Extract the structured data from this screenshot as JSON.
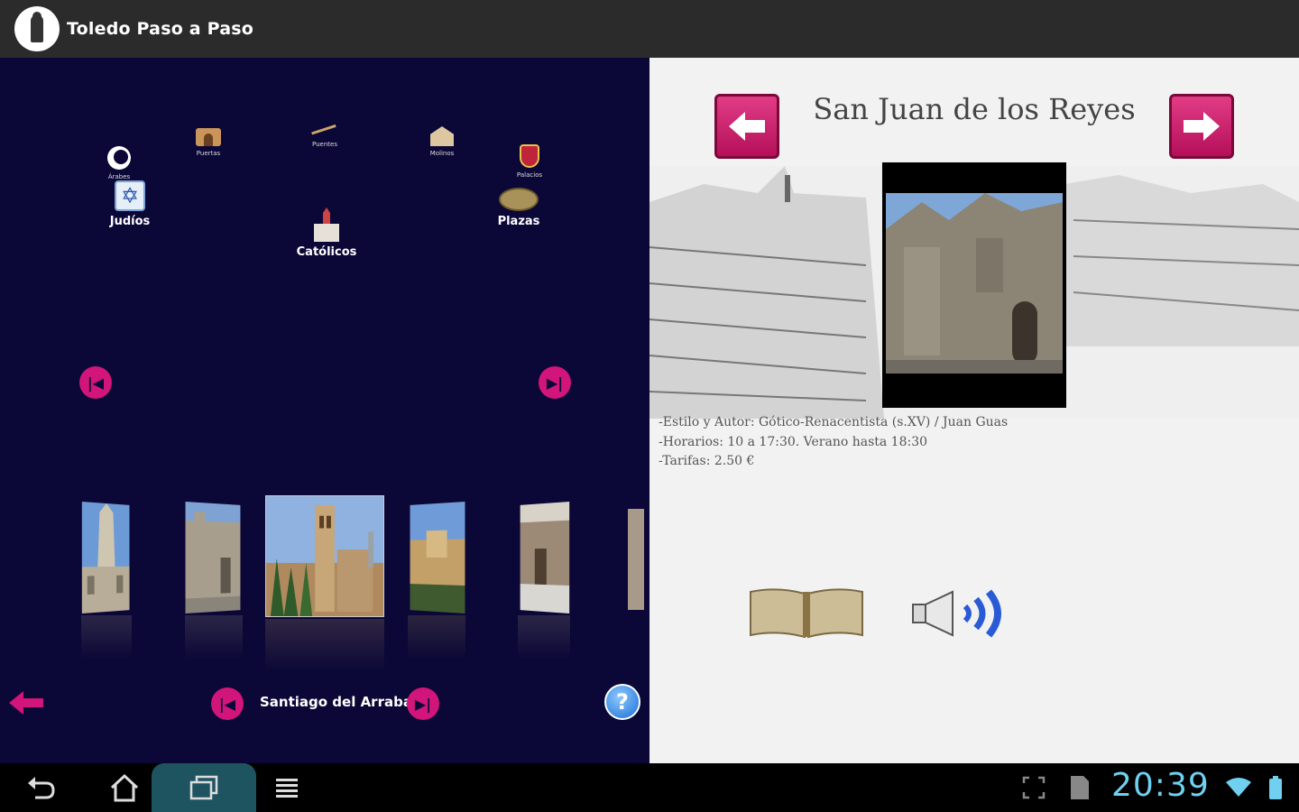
{
  "app": {
    "title": "Toledo Paso a Paso",
    "logo_icon": "walker-logo-icon"
  },
  "categories": [
    {
      "id": "arabes",
      "label": "Árabes",
      "icon": "crescent-moon-icon"
    },
    {
      "id": "judios",
      "label": "Judíos",
      "icon": "star-of-david-icon"
    },
    {
      "id": "puertas",
      "label": "Puertas",
      "icon": "arch-gate-icon"
    },
    {
      "id": "puentes",
      "label": "Puentes",
      "icon": "bridge-icon"
    },
    {
      "id": "molinos",
      "label": "Molinos",
      "icon": "mill-icon"
    },
    {
      "id": "catolicos",
      "label": "Católicos",
      "icon": "church-icon"
    },
    {
      "id": "palacios",
      "label": "Palacios",
      "icon": "shield-icon"
    },
    {
      "id": "plazas",
      "label": "Plazas",
      "icon": "plaza-icon"
    }
  ],
  "carousel": {
    "current_label": "Santiago del Arrabal",
    "first_button_icon": "skip-first-icon",
    "last_button_icon": "skip-last-icon"
  },
  "detail": {
    "title": "San Juan de los Reyes",
    "info_lines": [
      "-Estilo y Autor: Gótico-Renacentista (s.XV) / Juan Guas",
      "-Horarios: 10 a 17:30. Verano hasta 18:30",
      "-Tarifas: 2.50 €"
    ]
  },
  "system": {
    "time": "20:39"
  },
  "colors": {
    "accent": "#d1157a",
    "panel_bg": "#0b0736",
    "clock": "#6fd0f0"
  }
}
